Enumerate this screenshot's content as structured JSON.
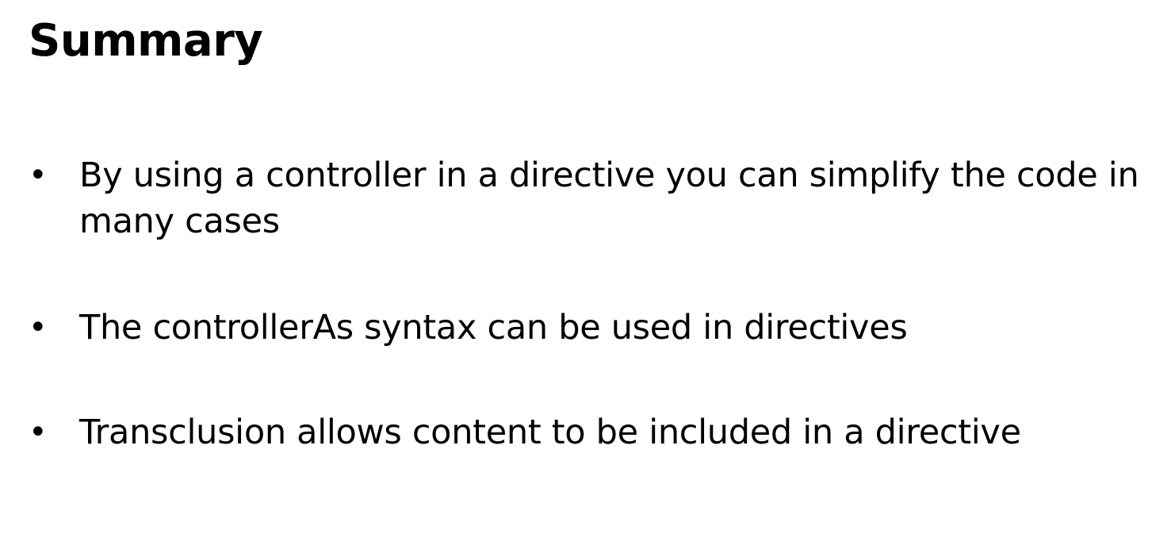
{
  "slide": {
    "title": "Summary",
    "bullets": [
      {
        "marker": "•",
        "text": "By using a controller in a directive you can simplify the code in many cases"
      },
      {
        "marker": "•",
        "text": "The controllerAs syntax can be used in directives"
      },
      {
        "marker": "•",
        "text": "Transclusion allows content to be included in a directive"
      }
    ]
  }
}
